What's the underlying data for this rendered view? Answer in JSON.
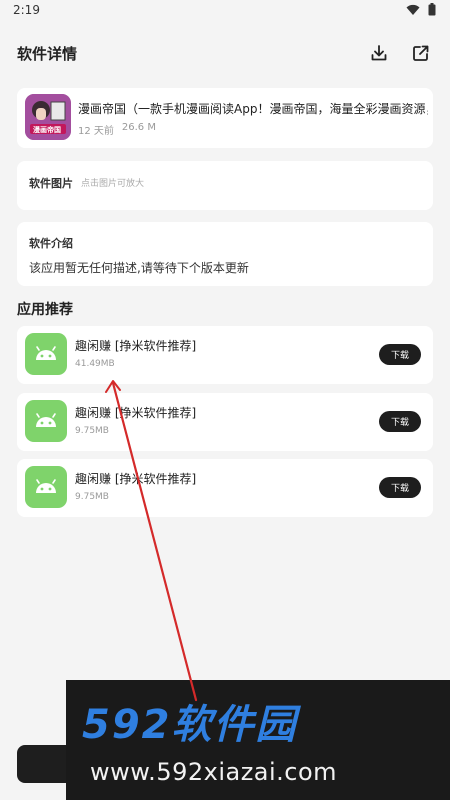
{
  "status": {
    "time": "2:19",
    "icons": [
      "wifi-icon",
      "battery-icon"
    ]
  },
  "header": {
    "title": "软件详情",
    "actions": [
      "download-icon",
      "share-icon"
    ]
  },
  "app": {
    "title": "漫画帝国（一款手机漫画阅读App！漫画帝国，海量全彩漫画资源，是",
    "time_ago": "12 天前",
    "size": "26.6 M",
    "icon_text": "漫画帝国"
  },
  "screenshots": {
    "label": "软件图片",
    "hint": "点击图片可放大"
  },
  "intro": {
    "label": "软件介绍",
    "text": "该应用暂无任何描述,请等待下个版本更新"
  },
  "recommend": {
    "title": "应用推荐",
    "items": [
      {
        "name": "趣闲赚 [挣米软件推荐]",
        "size": "41.49MB",
        "button": "下载"
      },
      {
        "name": "趣闲赚 [挣米软件推荐]",
        "size": "9.75MB",
        "button": "下载"
      },
      {
        "name": "趣闲赚 [挣米软件推荐]",
        "size": "9.75MB",
        "button": "下载"
      }
    ]
  },
  "watermark": {
    "main": "592软件园",
    "url": "www.592xiazai.com"
  },
  "colors": {
    "accent_green": "#7fd36b",
    "button_dark": "#1e1e1e",
    "watermark_blue": "#2f7fe0",
    "annotation_red": "#d42a2a"
  }
}
